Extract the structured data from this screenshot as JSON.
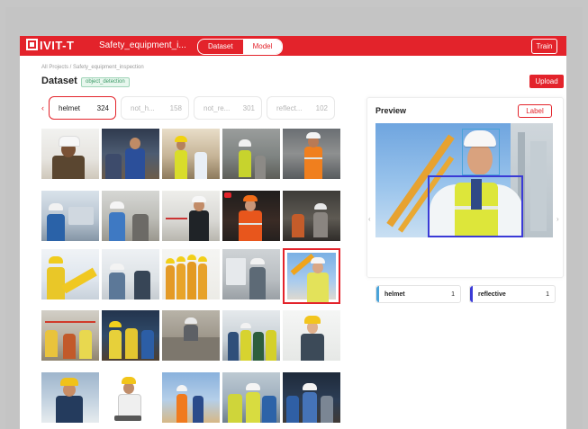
{
  "app": {
    "brand": "IVIT-T",
    "project_title": "Safety_equipment_i...",
    "tabs": [
      {
        "label": "Dataset",
        "active": true
      },
      {
        "label": "Model",
        "active": false
      }
    ],
    "train_label": "Train"
  },
  "breadcrumb": "All Projects / Safety_equipment_inspection",
  "header": {
    "title": "Dataset",
    "type_badge": "object_detection",
    "upload_label": "Upload"
  },
  "filters": {
    "prev_icon": "chevron-left-icon",
    "items": [
      {
        "label": "helmet",
        "count": "324",
        "active": true
      },
      {
        "label": "not_h...",
        "count": "158",
        "active": false
      },
      {
        "label": "not_re...",
        "count": "301",
        "active": false
      },
      {
        "label": "reflect...",
        "count": "102",
        "active": false
      }
    ]
  },
  "grid": {
    "selected_index": 14,
    "columns": 5,
    "rows": 5
  },
  "preview": {
    "title": "Preview",
    "label_button": "Label",
    "prev_icon": "chevron-left-icon",
    "next_icon": "chevron-right-icon",
    "annotations": [
      {
        "label": "helmet",
        "count": "1",
        "color": "#4aa3d9"
      },
      {
        "label": "reflective",
        "count": "1",
        "color": "#3a3ad6"
      }
    ]
  },
  "colors": {
    "brand": "#e3232b",
    "helmet_box": "#4aa3d9",
    "reflective_box": "#3a3ad6"
  }
}
